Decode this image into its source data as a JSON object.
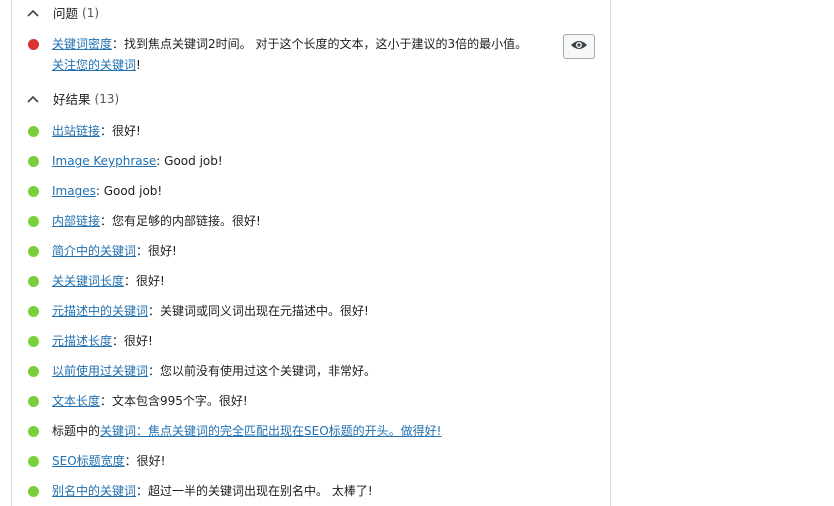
{
  "problems": {
    "title": "问题",
    "count": "(1)"
  },
  "problem_items": [
    {
      "link": "关键词密度",
      "text": "：找到焦点关键词2时间。 对于这个长度的文本，这小于建议的3倍的最小值。 ",
      "link2": "关注您的关键词",
      "end": "!"
    }
  ],
  "good": {
    "title": "好结果",
    "count": "(13)"
  },
  "good_items": [
    {
      "pre": "",
      "link": "出站链接",
      "text": "：很好!"
    },
    {
      "pre": "",
      "link": "Image Keyphrase",
      "text": ": Good job!"
    },
    {
      "pre": "",
      "link": "Images",
      "text": ": Good job!"
    },
    {
      "pre": "",
      "link": "内部链接",
      "text": "：您有足够的内部链接。很好!"
    },
    {
      "pre": "",
      "link": "简介中的关键词",
      "text": "：很好!"
    },
    {
      "pre": "",
      "link": "关关键词长度",
      "text": "：很好!"
    },
    {
      "pre": "",
      "link": "元描述中的关键词",
      "text": "：关键词或同义词出现在元描述中。很好!"
    },
    {
      "pre": "",
      "link": "元描述长度",
      "text": "：很好!"
    },
    {
      "pre": "",
      "link": "以前使用过关键词",
      "text": "：您以前没有使用过这个关键词，非常好。"
    },
    {
      "pre": "",
      "link": "文本长度",
      "text": "：文本包含995个字。很好!"
    },
    {
      "pre": "标题中的",
      "link": "关键词：焦点关键词的完全匹配出现在SEO标题的开头。做得好!",
      "text": ""
    },
    {
      "pre": "",
      "link": "SEO标题宽度",
      "text": "：很好!"
    },
    {
      "pre": "",
      "link": "别名中的关键词",
      "text": "：超过一半的关键词出现在别名中。 太棒了!"
    }
  ],
  "colors": {
    "problem": "#dc3232",
    "good": "#7ad03a",
    "link": "#2271b1"
  },
  "icons": {
    "collapse": "chevron-up-icon",
    "eye": "eye-icon"
  }
}
